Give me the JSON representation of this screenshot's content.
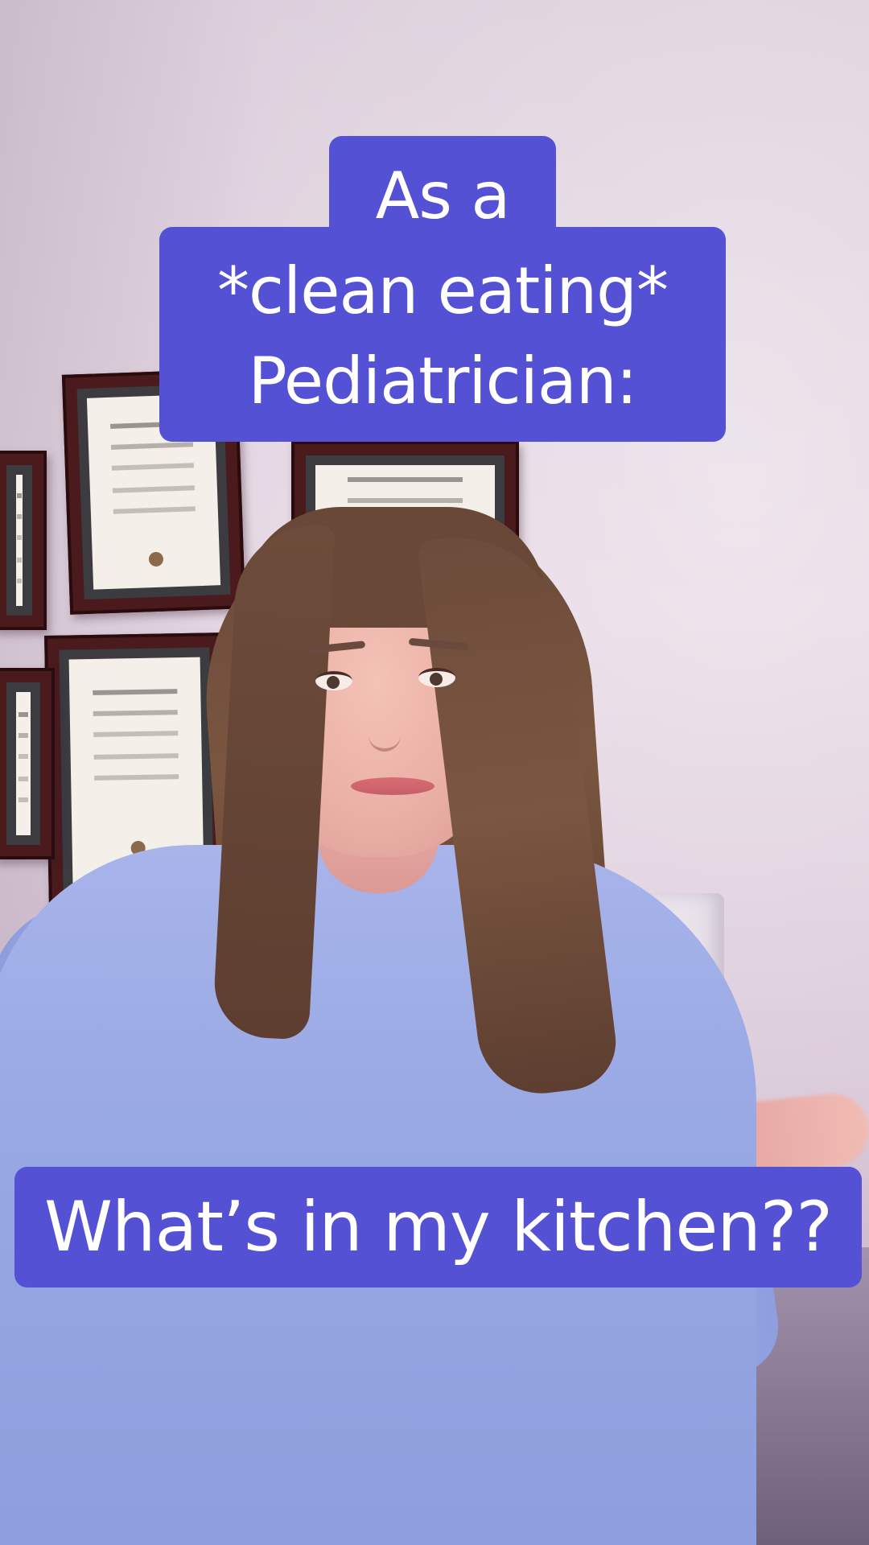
{
  "caption_top": {
    "line1": "As a",
    "line2": "*clean eating*",
    "line3": "Pediatrician:"
  },
  "caption_bottom": {
    "text": "What’s in my kitchen??"
  },
  "colors": {
    "caption_bg": "#5451d4",
    "caption_text": "#ffffff"
  }
}
